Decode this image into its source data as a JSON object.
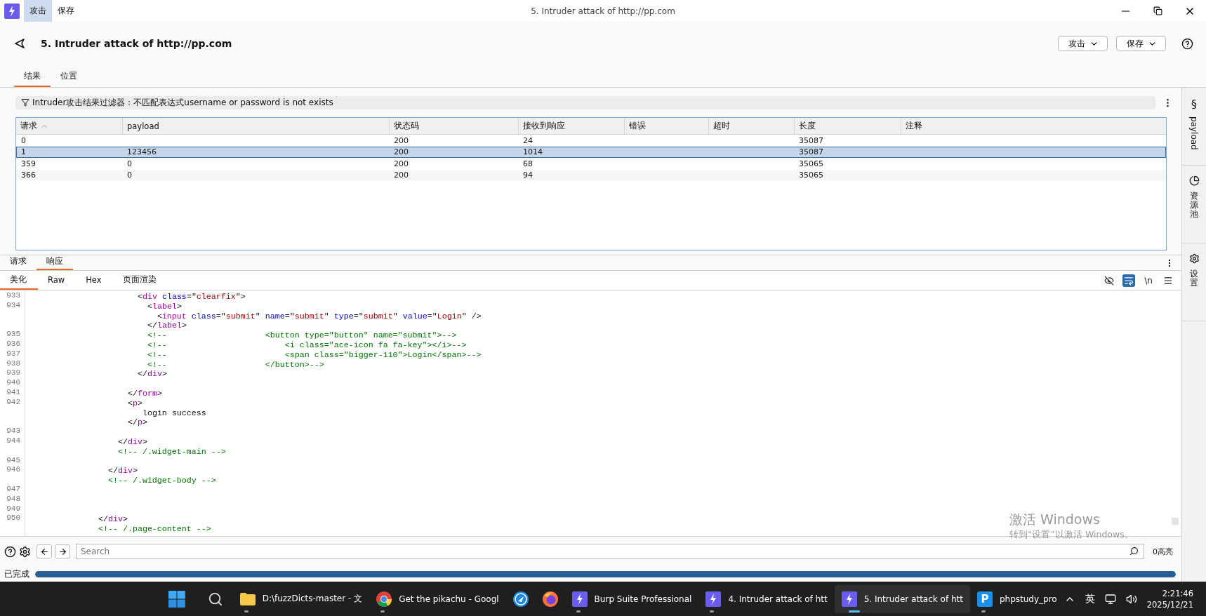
{
  "app_menu": [
    {
      "label": "攻击",
      "selected": true
    },
    {
      "label": "保存",
      "selected": false
    }
  ],
  "window": {
    "title": "5. Intruder attack of http://pp.com"
  },
  "header": {
    "title": "5. Intruder attack of http://pp.com",
    "buttons": [
      "攻击",
      "保存"
    ]
  },
  "tabs": [
    {
      "label": "结果",
      "selected": true
    },
    {
      "label": "位置",
      "selected": false
    }
  ],
  "filter": {
    "text": "Intruder攻击结果过滤器：不匹配表达式username or password is not exists"
  },
  "table": {
    "columns": [
      {
        "label": "请求",
        "sorted": true
      },
      {
        "label": "payload",
        "sorted": false
      },
      {
        "label": "状态码",
        "sorted": false
      },
      {
        "label": "接收到响应",
        "sorted": false
      },
      {
        "label": "错误",
        "sorted": false
      },
      {
        "label": "超时",
        "sorted": false
      },
      {
        "label": "长度",
        "sorted": false
      },
      {
        "label": "注释",
        "sorted": false
      }
    ],
    "rows": [
      {
        "cells": [
          "0",
          "",
          "200",
          "24",
          "",
          "",
          "35087",
          ""
        ],
        "selected": false
      },
      {
        "cells": [
          "1",
          "123456",
          "200",
          "1014",
          "",
          "",
          "35087",
          ""
        ],
        "selected": true
      },
      {
        "cells": [
          "359",
          "0",
          "200",
          "68",
          "",
          "",
          "35065",
          ""
        ],
        "selected": false
      },
      {
        "cells": [
          "366",
          "0",
          "200",
          "94",
          "",
          "",
          "35065",
          ""
        ],
        "selected": false
      }
    ]
  },
  "side_panel": [
    {
      "kind": "payload",
      "symbol": "§",
      "label": "payload"
    },
    {
      "kind": "pool",
      "label": "资源池"
    },
    {
      "kind": "settings",
      "label": "设置"
    }
  ],
  "message_tabs": [
    {
      "label": "请求",
      "selected": false
    },
    {
      "label": "响应",
      "selected": true
    }
  ],
  "view_tabs": [
    {
      "label": "美化",
      "selected": true
    },
    {
      "label": "Raw",
      "selected": false
    },
    {
      "label": "Hex",
      "selected": false
    },
    {
      "label": "页面渲染",
      "selected": false
    }
  ],
  "view_tools": [
    {
      "kind": "hidden",
      "on": false
    },
    {
      "kind": "wrap",
      "on": true
    },
    {
      "kind": "newline",
      "label": "\\n",
      "on": false
    },
    {
      "kind": "menu",
      "on": false
    }
  ],
  "code": [
    {
      "number": "933",
      "kind": "markup",
      "text": "                      <div class=\"clearfix\">"
    },
    {
      "number": "934",
      "kind": "markup",
      "text": "                        <label>"
    },
    {
      "kind": "markup",
      "text": "                          <input class=\"submit\" name=\"submit\" type=\"submit\" value=\"Login\" />"
    },
    {
      "kind": "markup",
      "text": "                        </label>"
    },
    {
      "number": "935",
      "kind": "comment",
      "text": "                        <!--                    <button type=\"button\" name=\"submit\">-->"
    },
    {
      "number": "936",
      "kind": "comment",
      "text": "                        <!--                        <i class=\"ace-icon fa fa-key\"></i>-->"
    },
    {
      "number": "937",
      "kind": "comment",
      "text": "                        <!--                        <span class=\"bigger-110\">Login</span>-->"
    },
    {
      "number": "938",
      "kind": "comment",
      "text": "                        <!--                    </button>-->"
    },
    {
      "number": "939",
      "kind": "markup",
      "text": "                      </div>"
    },
    {
      "number": "940"
    },
    {
      "number": "941",
      "kind": "markup",
      "text": "                    </form>"
    },
    {
      "number": "942",
      "kind": "markup",
      "text": "                    <p>"
    },
    {
      "kind": "markup",
      "text": "                       login success"
    },
    {
      "kind": "markup",
      "text": "                    </p>"
    },
    {
      "number": "943"
    },
    {
      "number": "944",
      "kind": "markup",
      "text": "                  </div>"
    },
    {
      "kind": "comment",
      "text": "                  <!-- /.widget-main -->"
    },
    {
      "number": "945"
    },
    {
      "number": "946",
      "kind": "markup",
      "text": "                </div>"
    },
    {
      "kind": "comment",
      "text": "                <!-- /.widget-body -->"
    },
    {
      "number": "947"
    },
    {
      "number": "948"
    },
    {
      "number": "949"
    },
    {
      "number": "950",
      "kind": "markup",
      "text": "              </div>"
    },
    {
      "kind": "comment",
      "text": "              <!-- /.page-content -->"
    }
  ],
  "search": {
    "placeholder": "Search",
    "highlights": "0高亮"
  },
  "status": {
    "text": "已完成",
    "level": 1
  },
  "taskbar": {
    "apps": [
      {
        "kind": "folder",
        "label": "D:\\fuzzDicts-master - 文",
        "running": true,
        "active": false
      },
      {
        "kind": "chrome",
        "label": "Get the pikachu - Googl",
        "running": true,
        "active": false
      },
      {
        "kind": "compass",
        "running": false,
        "active": false
      },
      {
        "kind": "firefox",
        "running": false,
        "active": false
      },
      {
        "kind": "burp",
        "label": "Burp Suite Professional",
        "running": true,
        "active": false
      },
      {
        "kind": "burp",
        "label": "4. Intruder attack of htt",
        "running": true,
        "active": false
      },
      {
        "kind": "burp",
        "label": "5. Intruder attack of htt",
        "running": true,
        "active": true
      },
      {
        "kind": "phpstudy",
        "badge": "P",
        "label": "phpstudy_pro",
        "running": true,
        "active": false
      }
    ],
    "ime": "英",
    "time": "2:21:46",
    "date": "2025/12/21"
  },
  "activation_notice": {
    "title": "激活 Windows",
    "text": "转到“设置”以激活 Windows。"
  }
}
